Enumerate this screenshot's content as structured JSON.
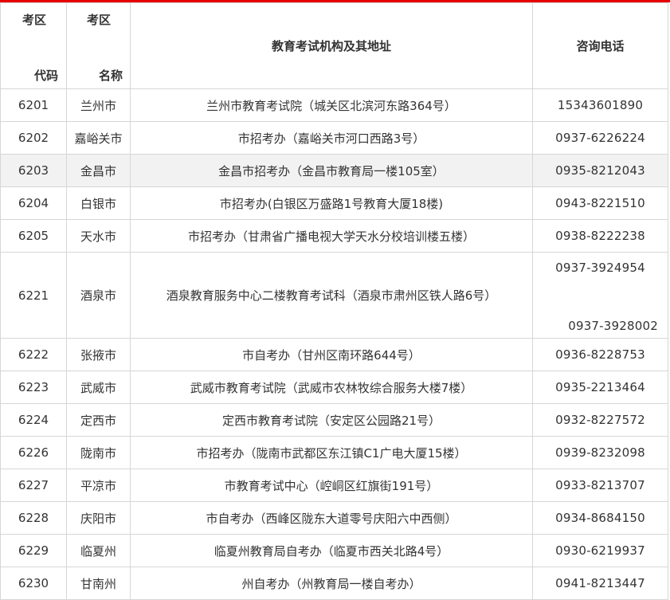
{
  "header": {
    "code_top": "考区",
    "code_bottom": "代码",
    "name_top": "考区",
    "name_bottom": "名称",
    "address": "教育考试机构及其地址",
    "phone": "咨询电话"
  },
  "rows": [
    {
      "code": "6201",
      "name": "兰州市",
      "address": "兰州市教育考试院（城关区北滨河东路364号）",
      "phone": "15343601890"
    },
    {
      "code": "6202",
      "name": "嘉峪关市",
      "address": "市招考办（嘉峪关市河口西路3号）",
      "phone": "0937-6226224"
    },
    {
      "code": "6203",
      "name": "金昌市",
      "address": "金昌市招考办（金昌市教育局一楼105室）",
      "phone": "0935-8212043"
    },
    {
      "code": "6204",
      "name": "白银市",
      "address": "市招考办(白银区万盛路1号教育大厦18楼)",
      "phone": "0943-8221510"
    },
    {
      "code": "6205",
      "name": "天水市",
      "address": "市招考办（甘肃省广播电视大学天水分校培训楼五楼）",
      "phone": "0938-8222238"
    },
    {
      "code": "6221",
      "name": "酒泉市",
      "address": "酒泉教育服务中心二楼教育考试科（酒泉市肃州区铁人路6号）",
      "phone": "0937-3924954",
      "phone2": "0937-3928002"
    },
    {
      "code": "6222",
      "name": "张掖市",
      "address": "市自考办（甘州区南环路644号）",
      "phone": "0936-8228753"
    },
    {
      "code": "6223",
      "name": "武威市",
      "address": "武威市教育考试院（武威市农林牧综合服务大楼7楼）",
      "phone": "0935-2213464"
    },
    {
      "code": "6224",
      "name": "定西市",
      "address": "定西市教育考试院（安定区公园路21号）",
      "phone": "0932-8227572"
    },
    {
      "code": "6226",
      "name": "陇南市",
      "address": "市招考办（陇南市武都区东江镇C1广电大厦15楼）",
      "phone": "0939-8232098"
    },
    {
      "code": "6227",
      "name": "平凉市",
      "address": "市教育考试中心（崆峒区红旗街191号）",
      "phone": "0933-8213707"
    },
    {
      "code": "6228",
      "name": "庆阳市",
      "address": "市自考办（西峰区陇东大道零号庆阳六中西侧）",
      "phone": "0934-8684150"
    },
    {
      "code": "6229",
      "name": "临夏州",
      "address": "临夏州教育局自考办（临夏市西关北路4号）",
      "phone": "0930-6219937"
    },
    {
      "code": "6230",
      "name": "甘南州",
      "address": "州自考办（州教育局一楼自考办）",
      "phone": "0941-8213447"
    }
  ],
  "colors": {
    "accent_line": "#e60000",
    "border": "#d6d6d6",
    "highlight_row": "#f2f2f2",
    "text": "#333333"
  }
}
